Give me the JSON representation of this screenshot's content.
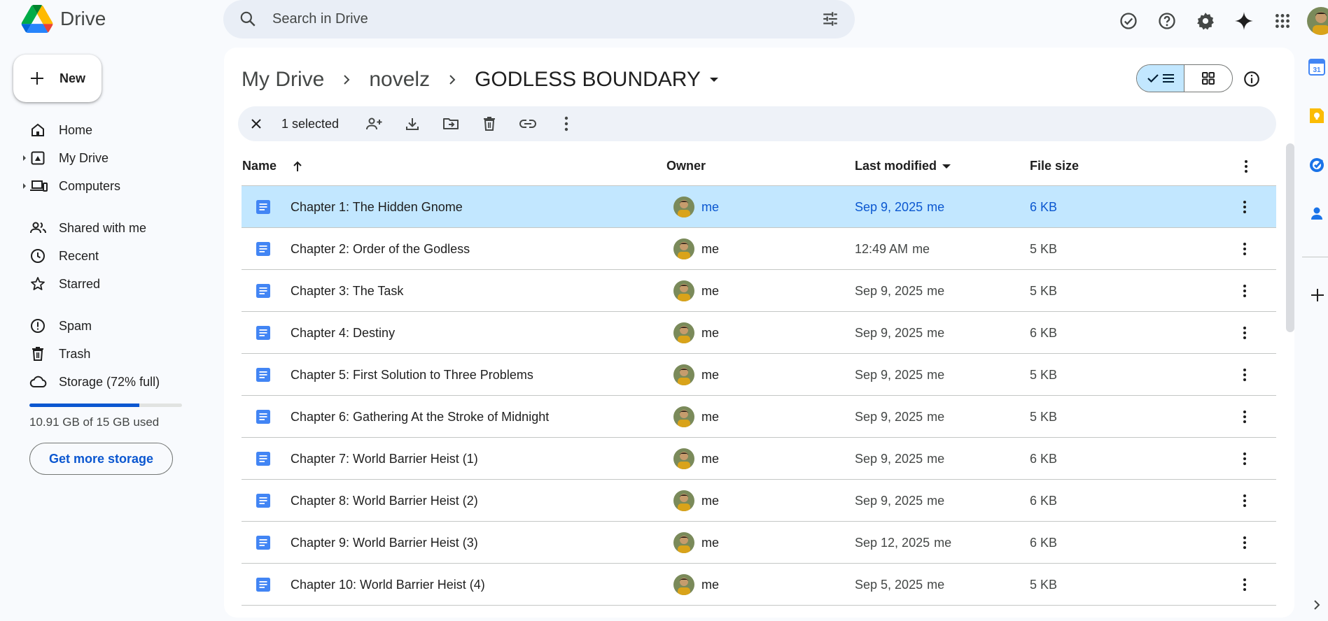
{
  "app": {
    "name": "Drive"
  },
  "search": {
    "placeholder": "Search in Drive"
  },
  "top_icons": [
    "ready-for-offline-icon",
    "help-icon",
    "settings-icon",
    "gemini-icon",
    "apps-grid-icon"
  ],
  "sidebar": {
    "new_label": "New",
    "items": [
      {
        "label": "Home",
        "icon": "home-icon"
      },
      {
        "label": "My Drive",
        "icon": "my-drive-icon",
        "expandable": true
      },
      {
        "label": "Computers",
        "icon": "computers-icon",
        "expandable": true
      },
      {
        "label": "Shared with me",
        "icon": "shared-icon"
      },
      {
        "label": "Recent",
        "icon": "clock-icon"
      },
      {
        "label": "Starred",
        "icon": "star-icon"
      },
      {
        "label": "Spam",
        "icon": "spam-icon"
      },
      {
        "label": "Trash",
        "icon": "trash-icon"
      },
      {
        "label": "Storage (72% full)",
        "icon": "cloud-icon"
      }
    ],
    "storage": {
      "used_fraction": 0.72,
      "text": "10.91 GB of 15 GB used",
      "button": "Get more storage"
    }
  },
  "breadcrumb": {
    "items": [
      "My Drive",
      "novelz",
      "GODLESS BOUNDARY"
    ]
  },
  "selection_bar": {
    "count_label": "1 selected",
    "actions": [
      "share-icon",
      "download-icon",
      "move-icon",
      "delete-icon",
      "copy-link-icon",
      "more-actions-icon"
    ]
  },
  "table": {
    "columns": {
      "name": "Name",
      "owner": "Owner",
      "modified": "Last modified",
      "size": "File size"
    },
    "rows": [
      {
        "name": "Chapter 1: The Hidden Gnome",
        "owner": "me",
        "modified": "Sep 9, 2025",
        "modified_by": "me",
        "size": "6 KB",
        "selected": true
      },
      {
        "name": "Chapter 2: Order of the Godless",
        "owner": "me",
        "modified": "12:49 AM",
        "modified_by": "me",
        "size": "5 KB",
        "selected": false
      },
      {
        "name": "Chapter 3: The Task",
        "owner": "me",
        "modified": "Sep 9, 2025",
        "modified_by": "me",
        "size": "5 KB",
        "selected": false
      },
      {
        "name": "Chapter 4: Destiny",
        "owner": "me",
        "modified": "Sep 9, 2025",
        "modified_by": "me",
        "size": "6 KB",
        "selected": false
      },
      {
        "name": "Chapter 5: First Solution to Three Problems",
        "owner": "me",
        "modified": "Sep 9, 2025",
        "modified_by": "me",
        "size": "5 KB",
        "selected": false
      },
      {
        "name": "Chapter 6: Gathering At the Stroke of Midnight",
        "owner": "me",
        "modified": "Sep 9, 2025",
        "modified_by": "me",
        "size": "5 KB",
        "selected": false
      },
      {
        "name": "Chapter 7: World Barrier Heist (1)",
        "owner": "me",
        "modified": "Sep 9, 2025",
        "modified_by": "me",
        "size": "6 KB",
        "selected": false
      },
      {
        "name": "Chapter 8: World Barrier Heist (2)",
        "owner": "me",
        "modified": "Sep 9, 2025",
        "modified_by": "me",
        "size": "6 KB",
        "selected": false
      },
      {
        "name": "Chapter 9: World Barrier Heist (3)",
        "owner": "me",
        "modified": "Sep 12, 2025",
        "modified_by": "me",
        "size": "6 KB",
        "selected": false
      },
      {
        "name": "Chapter 10: World Barrier Heist (4)",
        "owner": "me",
        "modified": "Sep 5, 2025",
        "modified_by": "me",
        "size": "5 KB",
        "selected": false
      }
    ]
  },
  "colors": {
    "selected_row": "#c2e7ff",
    "accent": "#0b57d0",
    "doc_icon": "#4285f4"
  }
}
